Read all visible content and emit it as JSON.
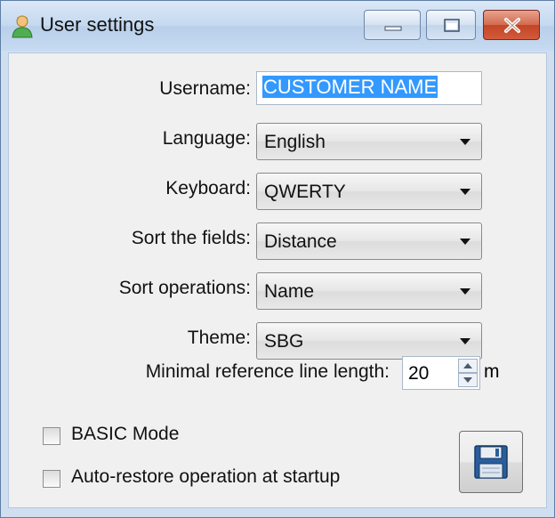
{
  "window": {
    "title": "User settings"
  },
  "fields": {
    "username_label": "Username:",
    "username_value": "CUSTOMER NAME",
    "language_label": "Language:",
    "language_value": "English",
    "keyboard_label": "Keyboard:",
    "keyboard_value": "QWERTY",
    "sort_fields_label": "Sort the fields:",
    "sort_fields_value": "Distance",
    "sort_ops_label": "Sort operations:",
    "sort_ops_value": "Name",
    "theme_label": "Theme:",
    "theme_value": "SBG",
    "min_ref_label": "Minimal reference line length:",
    "min_ref_value": "20",
    "min_ref_unit": "m"
  },
  "options": {
    "basic_mode_label": "BASIC Mode",
    "basic_mode_checked": false,
    "auto_restore_label": "Auto-restore operation at startup",
    "auto_restore_checked": false
  },
  "icons": {
    "app": "user-icon",
    "minimize": "minimize-icon",
    "maximize": "maximize-icon",
    "close": "close-icon",
    "dropdown": "chevron-down-icon",
    "save": "floppy-disk-icon"
  }
}
